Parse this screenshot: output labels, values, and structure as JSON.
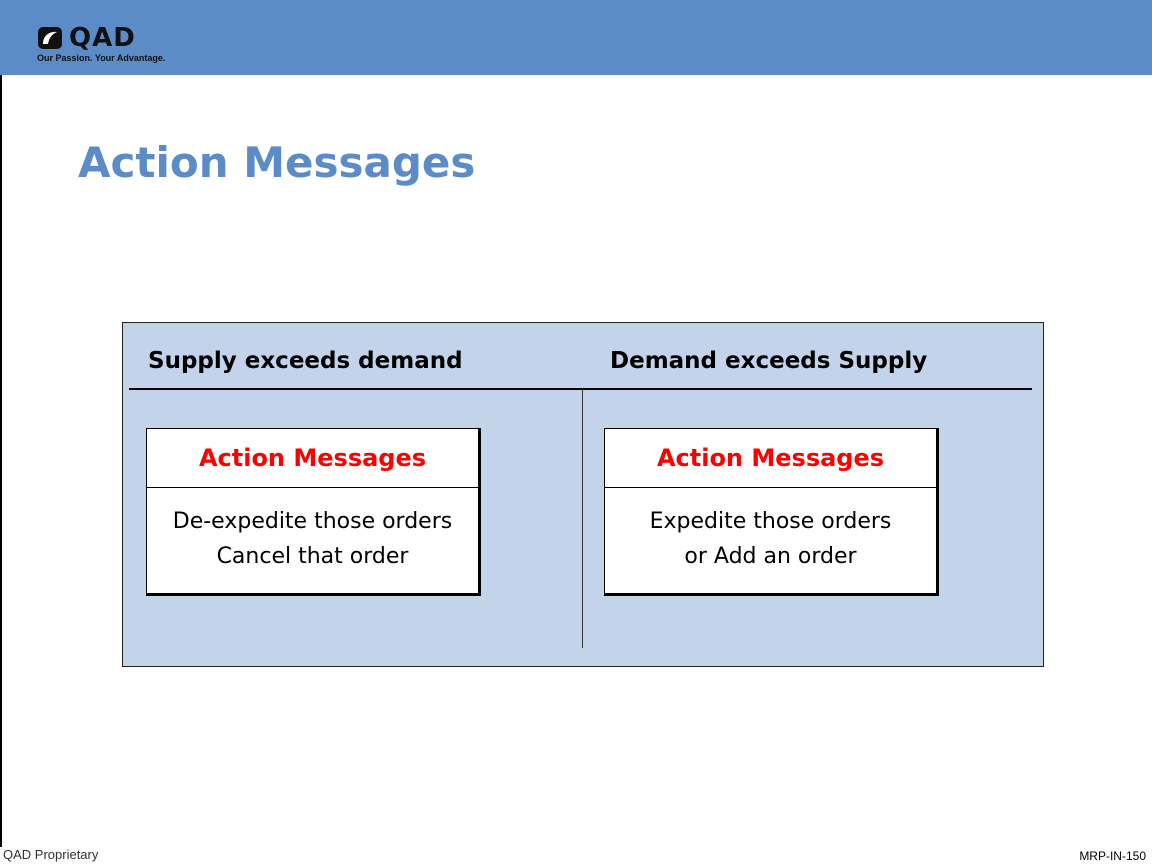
{
  "header": {
    "bar_color": "#5b8cc8",
    "logo": {
      "wordmark": "QAD",
      "tagline": "Our Passion. Your Advantage.",
      "icon": "qad-logo-icon"
    }
  },
  "slide": {
    "title": "Action Messages",
    "title_color": "#5b8cc8"
  },
  "panel": {
    "background": "#c3d3e9",
    "columns": [
      {
        "heading": "Supply exceeds demand",
        "box_title": "Action Messages",
        "lines": [
          "De-expedite those orders",
          "Cancel that order"
        ]
      },
      {
        "heading": "Demand exceeds Supply",
        "box_title": "Action Messages",
        "lines": [
          "Expedite those orders",
          "or Add an order"
        ]
      }
    ],
    "box_title_color": "#ff0000"
  },
  "footer": {
    "left": "QAD Proprietary",
    "right": "MRP-IN-150"
  }
}
